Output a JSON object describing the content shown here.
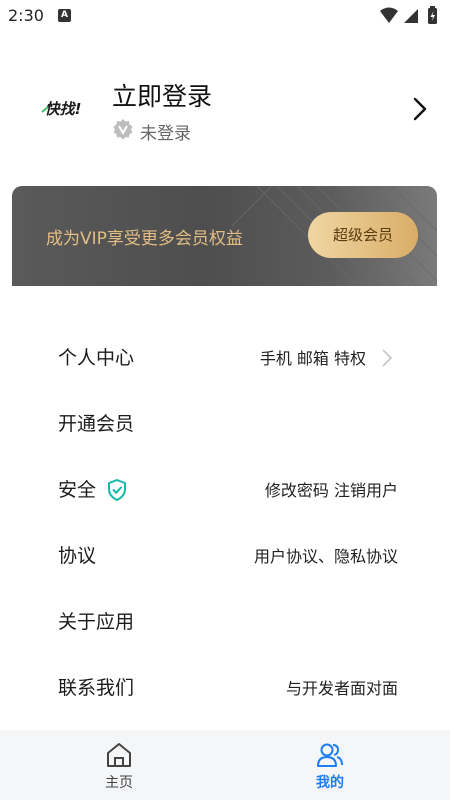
{
  "status_bar": {
    "time": "2:30",
    "notification_letter": "A"
  },
  "header": {
    "avatar_text": "快找!",
    "title": "立即登录",
    "subtitle": "未登录"
  },
  "vip": {
    "text": "成为VIP享受更多会员权益",
    "button_label": "超级会员"
  },
  "menu": [
    {
      "label": "个人中心",
      "value": "手机 邮箱 特权"
    },
    {
      "label": "开通会员",
      "value": ""
    },
    {
      "label": "安全",
      "value": "修改密码  注销用户"
    },
    {
      "label": "协议",
      "value": "用户协议、隐私协议"
    },
    {
      "label": "关于应用",
      "value": ""
    },
    {
      "label": "联系我们",
      "value": "与开发者面对面"
    }
  ],
  "nav": [
    {
      "label": "主页",
      "icon": "home-icon"
    },
    {
      "label": "我的",
      "icon": "users-icon"
    }
  ],
  "colors": {
    "accent": "#1f7df1",
    "vip_gold": "#e2bd84",
    "shield": "#14b8a6"
  }
}
